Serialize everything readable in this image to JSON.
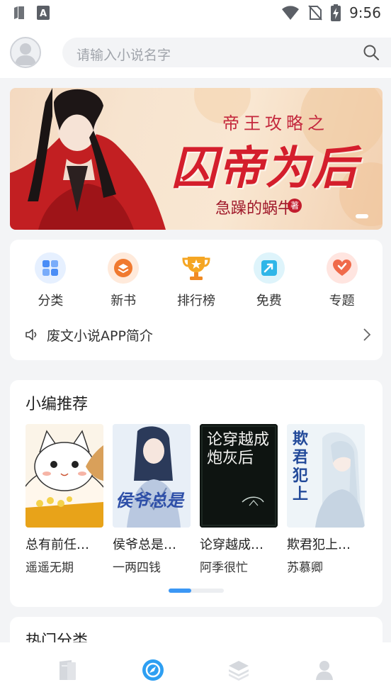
{
  "status_bar": {
    "time": "9:56",
    "icons": [
      "sim-card-icon",
      "app-a-icon",
      "wifi-icon",
      "no-sim-icon",
      "battery-charging-icon"
    ]
  },
  "search": {
    "placeholder": "请输入小说名字"
  },
  "banner": {
    "subtitle": "帝王攻略之",
    "title": "囚帝为后",
    "author": "急躁的蜗牛",
    "author_badge": "著"
  },
  "menu": {
    "items": [
      {
        "label": "分类",
        "icon": "grid-icon",
        "color": "#4a8df6"
      },
      {
        "label": "新书",
        "icon": "new-book-icon",
        "color": "#f07a30"
      },
      {
        "label": "排行榜",
        "icon": "trophy-icon",
        "color": "#f5a623"
      },
      {
        "label": "免费",
        "icon": "free-icon",
        "color": "#2fb6e8"
      },
      {
        "label": "专题",
        "icon": "heart-icon",
        "color": "#f06a4a"
      }
    ],
    "intro": "废文小说APP简介"
  },
  "recommend": {
    "title": "小编推荐",
    "books": [
      {
        "title": "总有前任…",
        "author": "遥遥无期"
      },
      {
        "title": "侯爷总是…",
        "author": "一两四钱",
        "cover_text": "侯爷总是"
      },
      {
        "title": "论穿越成…",
        "author": "阿季很忙",
        "cover_text": "论穿越成炮灰后"
      },
      {
        "title": "欺君犯上…",
        "author": "苏慕卿",
        "cover_text": "欺君犯上"
      }
    ]
  },
  "hot": {
    "title": "热门分类"
  },
  "tabs": [
    "bookshelf-icon",
    "discover-icon",
    "category-icon",
    "profile-icon"
  ]
}
